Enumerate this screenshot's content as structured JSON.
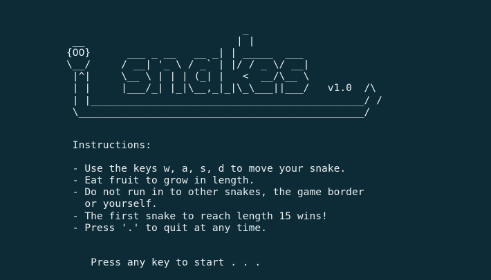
{
  "banner": {
    "lines": [
      "                             _",
      " __                         | |",
      "{OO}      ___ _ __   __ _| | _____  ___",
      "\\__/     / __| '_ \\ / _` | |/ / _ \\/ __|",
      " |^|     \\__ \\ | | | (_| |   <  __/\\__ \\",
      " | |     |___/_| |_|\\__,_|_|\\_\\___||___/   v1.0  /\\",
      " | |_____________________________________________/ /",
      " \\_______________________________________________/"
    ]
  },
  "instructions": {
    "heading": " Instructions:",
    "lines": [
      " - Use the keys w, a, s, d to move your snake.",
      " - Eat fruit to grow in length.",
      " - Do not run in to other snakes, the game border",
      "   or yourself.",
      " - The first snake to reach length 15 wins!",
      " - Press '.' to quit at any time."
    ]
  },
  "prompt": "Press any key to start . . ."
}
